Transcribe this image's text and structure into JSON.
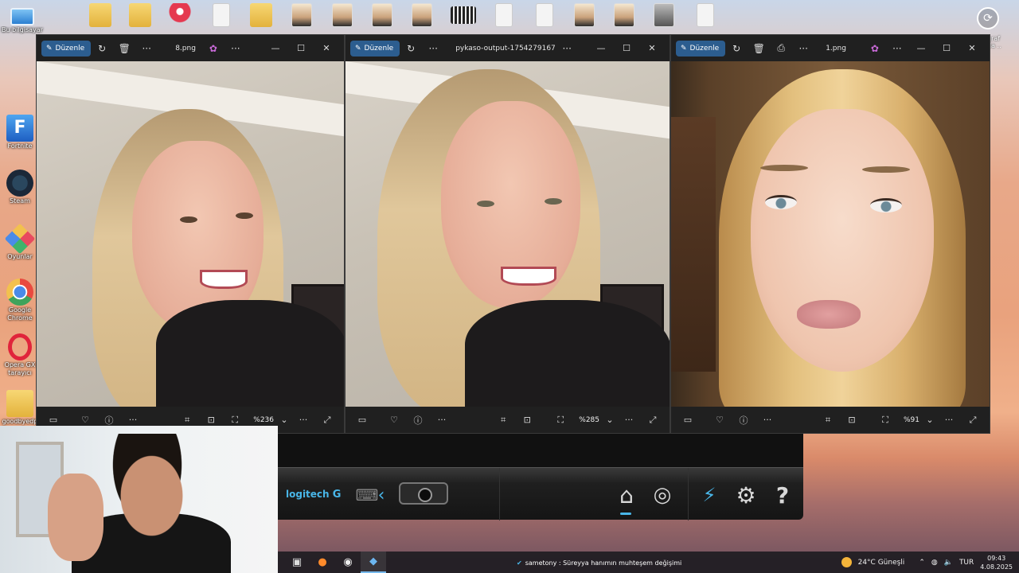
{
  "desktop": {
    "top_icons": [
      {
        "label": "Bu bilgisayar",
        "kind": "pc"
      },
      {
        "label": "",
        "kind": "folder"
      },
      {
        "label": "",
        "kind": "folder"
      },
      {
        "label": "",
        "kind": "pin"
      },
      {
        "label": "",
        "kind": "doc"
      },
      {
        "label": "",
        "kind": "folder"
      },
      {
        "label": "",
        "kind": "photo"
      },
      {
        "label": "",
        "kind": "photo"
      },
      {
        "label": "",
        "kind": "photo"
      },
      {
        "label": "",
        "kind": "photo"
      },
      {
        "label": "",
        "kind": "film"
      },
      {
        "label": "",
        "kind": "doc"
      },
      {
        "label": "",
        "kind": "doc"
      },
      {
        "label": "",
        "kind": "photo"
      },
      {
        "label": "",
        "kind": "photo"
      },
      {
        "label": "",
        "kind": "photo"
      },
      {
        "label": "",
        "kind": "doc"
      }
    ],
    "left_icons": [
      {
        "label": "Fortnite"
      },
      {
        "label": "Steam"
      },
      {
        "label": "Oyunlar"
      },
      {
        "label": "Google Chrome"
      },
      {
        "label": "Opera GX tarayıcı"
      },
      {
        "label": "goodbyedp"
      }
    ],
    "right_label": "...graf\n...da ...",
    "colors": {
      "accent": "#2c5d8f",
      "logitech": "#49b6e8"
    }
  },
  "windows": [
    {
      "edit_label": "Düzenle",
      "title": "8.png",
      "zoom": "%236"
    },
    {
      "edit_label": "Düzenle",
      "title": "pykaso-output-175427916712...",
      "zoom": "%285"
    },
    {
      "edit_label": "Düzenle",
      "title": "1.png",
      "zoom": "%91"
    }
  ],
  "logitech": {
    "brand": "logitech"
  },
  "taskbar": {
    "toast_text": "sametony : Süreyya hanımın muhteşem değişimi",
    "weather": "24°C Güneşli",
    "lang": "TUR",
    "time": "09:43",
    "date": "4.08.2025"
  }
}
